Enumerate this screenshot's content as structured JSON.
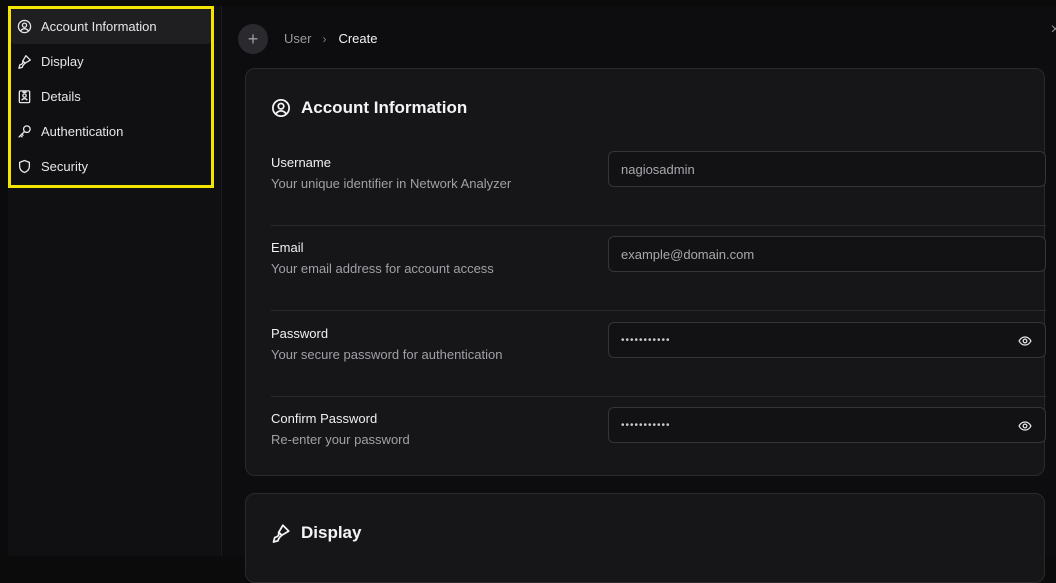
{
  "sidebar": {
    "items": [
      {
        "label": "Account Information",
        "icon": "user-circle-icon",
        "active": true
      },
      {
        "label": "Display",
        "icon": "paintbrush-icon",
        "active": false
      },
      {
        "label": "Details",
        "icon": "id-badge-icon",
        "active": false
      },
      {
        "label": "Authentication",
        "icon": "key-icon",
        "active": false
      },
      {
        "label": "Security",
        "icon": "shield-icon",
        "active": false
      }
    ],
    "highlight_color": "#f2e600"
  },
  "header": {
    "add_symbol": "+",
    "breadcrumb": [
      "User",
      "Create"
    ],
    "breadcrumb_separator": "›",
    "close_symbol": "×"
  },
  "account": {
    "title": "Account Information",
    "fields": [
      {
        "label": "Username",
        "hint": "Your unique identifier in Network Analyzer",
        "placeholder": "nagiosadmin",
        "value": ""
      },
      {
        "label": "Email",
        "hint": "Your email address for account access",
        "placeholder": "example@domain.com",
        "value": ""
      },
      {
        "label": "Password",
        "hint": "Your secure password for authentication",
        "placeholder": "",
        "value": "•••••••••••"
      },
      {
        "label": "Confirm Password",
        "hint": "Re-enter your password",
        "placeholder": "",
        "value": "•••••••••••"
      }
    ]
  },
  "display": {
    "title": "Display"
  }
}
